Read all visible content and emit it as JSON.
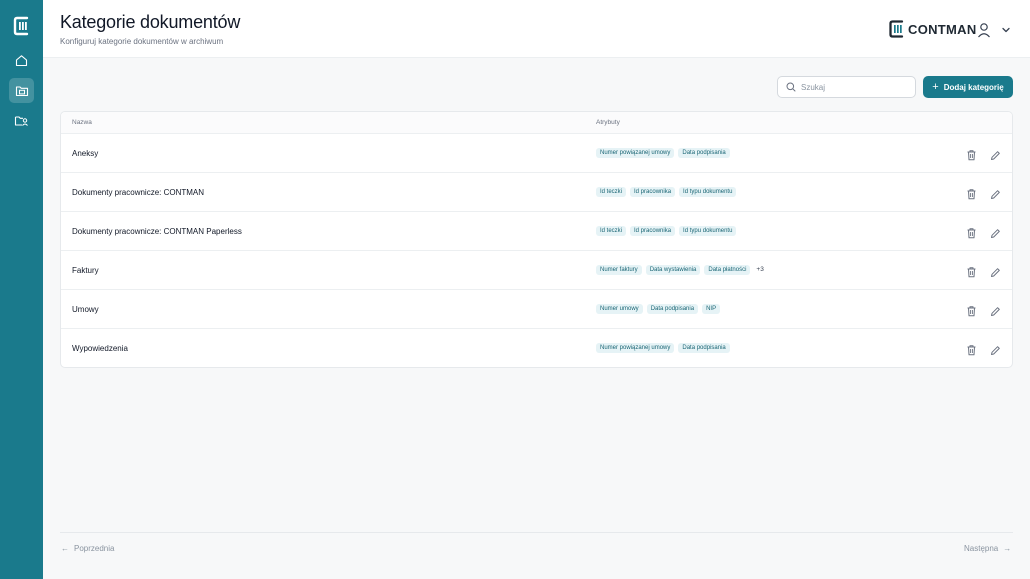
{
  "header": {
    "title": "Kategorie dokumentów",
    "subtitle": "Konfiguruj kategorie dokumentów w archiwum",
    "brand": "CONTMAN"
  },
  "sidebar": {
    "items": [
      {
        "icon": "home-icon"
      },
      {
        "icon": "folder-documents-icon",
        "active": true
      },
      {
        "icon": "folder-users-icon"
      }
    ]
  },
  "toolbar": {
    "search_placeholder": "Szukaj",
    "add_label": "Dodaj kategorię"
  },
  "table": {
    "columns": [
      "Nazwa",
      "Atrybuty"
    ],
    "rows": [
      {
        "name": "Aneksy",
        "tags": [
          "Numer powiązanej umowy",
          "Data podpisania"
        ],
        "more": ""
      },
      {
        "name": "Dokumenty pracownicze: CONTMAN",
        "tags": [
          "Id teczki",
          "Id pracownika",
          "Id typu dokumentu"
        ],
        "more": ""
      },
      {
        "name": "Dokumenty pracownicze: CONTMAN Paperless",
        "tags": [
          "Id teczki",
          "Id pracownika",
          "Id typu dokumentu"
        ],
        "more": ""
      },
      {
        "name": "Faktury",
        "tags": [
          "Numer faktury",
          "Data wystawienia",
          "Data płatności"
        ],
        "more": "+3"
      },
      {
        "name": "Umowy",
        "tags": [
          "Numer umowy",
          "Data podpisania",
          "NIP"
        ],
        "more": ""
      },
      {
        "name": "Wypowiedzenia",
        "tags": [
          "Numer powiązanej umowy",
          "Data podpisania"
        ],
        "more": ""
      }
    ]
  },
  "pagination": {
    "prev_label": "Poprzednia",
    "next_label": "Następna"
  },
  "colors": {
    "accent": "#1a7a8c",
    "tag_bg": "#e6f3f6",
    "tag_text": "#1a6675"
  }
}
